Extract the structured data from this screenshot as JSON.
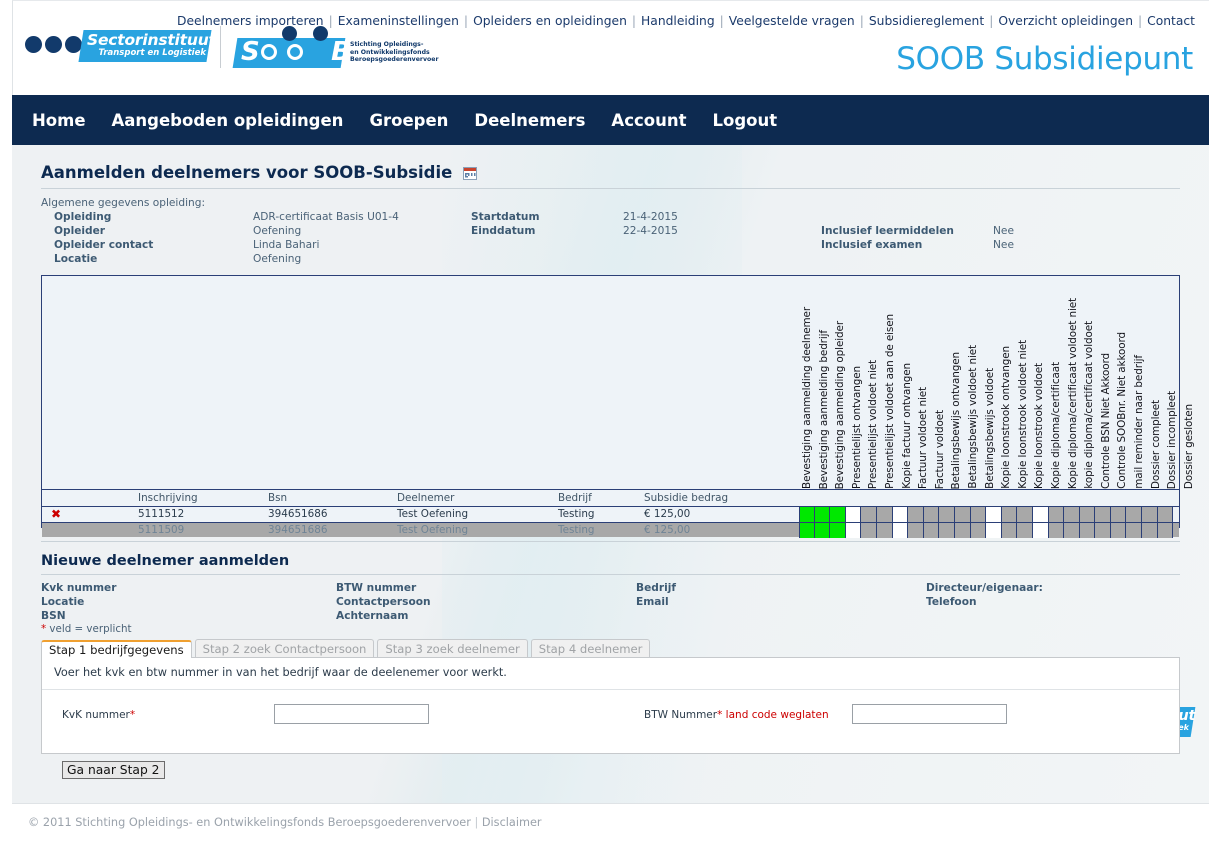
{
  "topnav": {
    "links": [
      "Deelnemers importeren",
      "Exameninstellingen",
      "Opleiders en opleidingen",
      "Handleiding",
      "Veelgestelde vragen",
      "Subsidiereglement",
      "Overzicht opleidingen",
      "Contact"
    ]
  },
  "logos": {
    "sector_line1": "Sectorinstituut",
    "sector_line2": "Transport en Logistiek",
    "soob_word": "S   O   O   B",
    "soob_sub": "Stichting Opleidings-\nen Ontwikkelingsfonds\nBeroepsgoederenvervoer",
    "brand_title": "SOOB Subsidiepunt"
  },
  "mainnav": {
    "items": [
      "Home",
      "Aangeboden opleidingen",
      "Groepen",
      "Deelnemers",
      "Account",
      "Logout"
    ]
  },
  "page": {
    "title": "Aanmelden deelnemers voor SOOB-Subsidie",
    "info_lead": "Algemene gegevens opleiding:",
    "info": {
      "opleiding_label": "Opleiding",
      "opleiding_value": "ADR-certificaat Basis U01-4",
      "opleider_label": "Opleider",
      "opleider_value": "Oefening",
      "opleider_contact_label": "Opleider contact",
      "opleider_contact_value": "Linda Bahari",
      "locatie_label": "Locatie",
      "locatie_value": "Oefening",
      "startdatum_label": "Startdatum",
      "startdatum_value": "21-4-2015",
      "einddatum_label": "Einddatum",
      "einddatum_value": "22-4-2015",
      "leermiddelen_label": "Inclusief leermiddelen",
      "leermiddelen_value": "Nee",
      "examen_label": "Inclusief examen",
      "examen_value": "Nee"
    }
  },
  "table": {
    "columns": [
      "Inschrijving",
      "Bsn",
      "Deelnemer",
      "Bedrijf",
      "Subsidie bedrag"
    ],
    "status_columns": [
      "Bevestiging aanmelding deelnemer",
      "Bevestiging aanmelding bedrijf",
      "Bevestiging aanmelding opleider",
      "Presentielijst ontvangen",
      "Presentielijst voldoet niet",
      "Presentielijst voldoet aan de eisen",
      "Kopie factuur ontvangen",
      "Factuur voldoet niet",
      "Factuur voldoet",
      "Betalingsbewijs ontvangen",
      "Betalingsbewijs voldoet niet",
      "Betalingsbewijs voldoet",
      "Kopie loonstrook ontvangen",
      "Kopie loonstrook voldoet niet",
      "Kopie loonstrook voldoet",
      "Kopie diploma/certificaat",
      "Kopie diploma/certificaat voldoet niet",
      "kopie diploma/certificaat voldoet",
      "Controle BSN Niet Akkoord",
      "Controle SOOBnr. Niet akkoord",
      "mail reminder naar bedrijf",
      "Dossier compleet",
      "Dossier incompleet",
      "Dossier gesloten"
    ],
    "rows": [
      {
        "delete_icon": "✖",
        "inschrijving": "5111512",
        "bsn": "394651686",
        "deelnemer": "Test Oefening",
        "bedrijf": "Testing",
        "subsidie": "€ 125,00",
        "states": [
          "green",
          "green",
          "green",
          "white",
          "gray",
          "gray",
          "white",
          "gray",
          "gray",
          "gray",
          "gray",
          "gray",
          "white",
          "gray",
          "gray",
          "white",
          "gray",
          "gray",
          "gray",
          "gray",
          "gray",
          "gray",
          "gray",
          "gray"
        ]
      },
      {
        "delete_icon": "",
        "inschrijving": "5111509",
        "bsn": "394651686",
        "deelnemer": "Test Oefening",
        "bedrijf": "Testing",
        "subsidie": "€ 125,00",
        "states": [
          "green",
          "green",
          "green",
          "white",
          "gray",
          "gray",
          "white",
          "gray",
          "gray",
          "gray",
          "gray",
          "gray",
          "white",
          "gray",
          "gray",
          "white",
          "gray",
          "gray",
          "gray",
          "gray",
          "gray",
          "gray",
          "gray",
          "gray"
        ]
      }
    ]
  },
  "newparticipant": {
    "title": "Nieuwe deelnemer aanmelden",
    "labels": {
      "kvk": "Kvk nummer",
      "locatie": "Locatie",
      "bsn": "BSN",
      "btw": "BTW nummer",
      "contactpersoon": "Contactpersoon",
      "achternaam": "Achternaam",
      "bedrijf": "Bedrijf",
      "email": "Email",
      "directeur": "Directeur/eigenaar:",
      "telefoon": "Telefoon"
    },
    "required_note_star": "*",
    "required_note": " veld = verplicht",
    "tabs": [
      {
        "label": "Stap 1 bedrijfgegevens",
        "active": true
      },
      {
        "label": "Stap 2 zoek Contactpersoon",
        "active": false
      },
      {
        "label": "Stap 3 zoek deelnemer",
        "active": false
      },
      {
        "label": "Stap 4 deelnemer",
        "active": false
      }
    ],
    "panel": {
      "help": "Voer het kvk en btw nummer in van het bedrijf waar de deelenemer voor werkt.",
      "kvk_label": "KvK nummer",
      "kvk_star": "*",
      "kvk_value": "",
      "btw_label": "BTW Nummer",
      "btw_star": "*",
      "btw_hint": " land code weglaten",
      "btw_value": "",
      "submit_label": "Ga naar Stap 2"
    }
  },
  "footer": {
    "copyright": "© 2011 Stichting Opleidings- en Ontwikkelingsfonds Beroepsgoederenvervoer",
    "separator": "|",
    "disclaimer": "Disclaimer"
  },
  "colors": {
    "navy": "#0d2a50",
    "brand_blue": "#29a3e0",
    "status_green": "#00e800",
    "status_gray": "#a8a8a8",
    "accent_orange": "#f0a030",
    "required_red": "#cc0000"
  }
}
